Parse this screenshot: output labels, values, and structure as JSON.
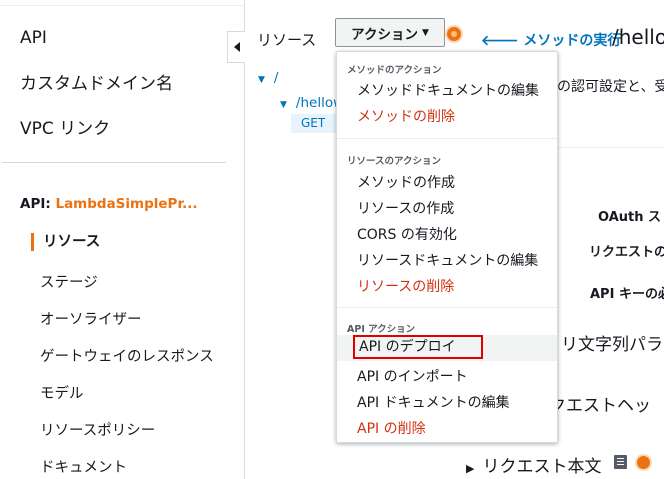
{
  "nav": {
    "top_items": [
      "API",
      "カスタムドメイン名",
      "VPC リンク"
    ],
    "api_prefix": "API: ",
    "api_name": "LambdaSimplePr...",
    "active_item": "リソース",
    "sub_items": [
      "ステージ",
      "オーソライザー",
      "ゲートウェイのレスポンス",
      "モデル",
      "リソースポリシー",
      "ドキュメント"
    ]
  },
  "resources": {
    "title": "リソース",
    "actions_label": "アクション",
    "tree": {
      "root": "/",
      "child": "/hellow",
      "method": "GET"
    }
  },
  "method_detail": {
    "exec_link": "メソッドの実行",
    "path": "/hello",
    "auth_desc": "の認可設定と、受",
    "labels": {
      "oauth": "OAuth ス",
      "request": "リクエストの",
      "api_key": "API キーの必"
    },
    "sections": {
      "query": "リ文字列パラ",
      "headers": "クエストヘッ",
      "body": "リクエスト本文"
    }
  },
  "actions_menu": {
    "method_header": "メソッドのアクション",
    "method_items": [
      {
        "label": "メソッドドキュメントの編集",
        "danger": false
      },
      {
        "label": "メソッドの削除",
        "danger": true
      }
    ],
    "resource_header": "リソースのアクション",
    "resource_items": [
      {
        "label": "メソッドの作成",
        "danger": false
      },
      {
        "label": "リソースの作成",
        "danger": false
      },
      {
        "label": "CORS の有効化",
        "danger": false
      },
      {
        "label": "リソースドキュメントの編集",
        "danger": false
      },
      {
        "label": "リソースの削除",
        "danger": true
      }
    ],
    "api_header": "API アクション",
    "api_items": [
      {
        "label": "API のデプロイ",
        "danger": false,
        "highlighted": true
      },
      {
        "label": "API のインポート",
        "danger": false
      },
      {
        "label": "API ドキュメントの編集",
        "danger": false
      },
      {
        "label": "API の削除",
        "danger": true
      }
    ]
  },
  "colors": {
    "accent": "#ec7211",
    "link": "#0073bb",
    "danger": "#d13212",
    "highlight_border": "#e00000"
  }
}
